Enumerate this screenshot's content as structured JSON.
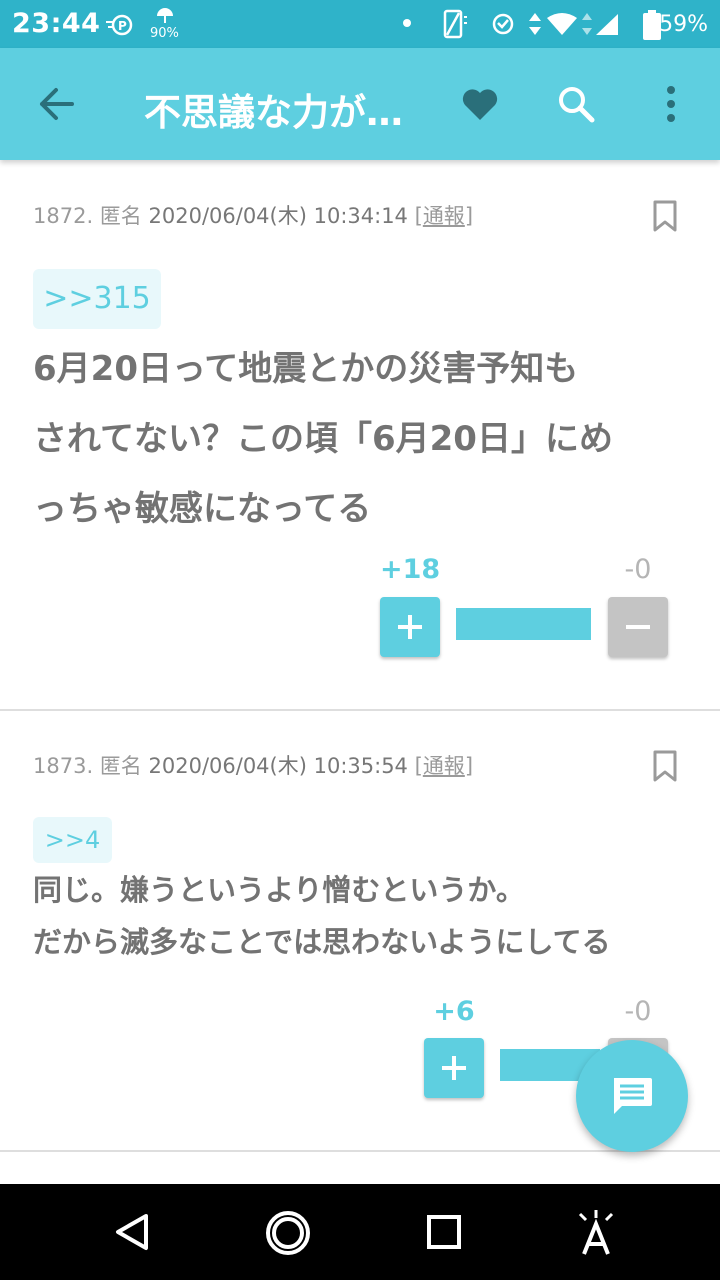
{
  "status_bar": {
    "time": "23:44",
    "small_label": "90%",
    "battery": "59%"
  },
  "app_bar": {
    "title": "不思議な力が…",
    "colors": {
      "bar": "#5ecfe0",
      "status": "#2fb3c9",
      "heart": "#2a6f7a"
    }
  },
  "posts": [
    {
      "number": "1872.",
      "author": "匿名",
      "datetime": "2020/06/04(木) 10:34:14",
      "report_open": "[",
      "report": "通報",
      "report_close": "]",
      "anchor": ">>315",
      "lines": [
        "6月20日って地震とかの災害予知も",
        "されてない？この頃「6月20日」にめ",
        "っちゃ敏感になってる"
      ],
      "plus_count": "+18",
      "minus_count": "-0",
      "plus_fraction": 1.0
    },
    {
      "number": "1873.",
      "author": "匿名",
      "datetime": "2020/06/04(木) 10:35:54",
      "report_open": "[",
      "report": "通報",
      "report_close": "]",
      "anchor": ">>4",
      "lines": [
        "同じ。嫌うというより憎むというか。",
        "だから滅多なことでは思わないようにしてる"
      ],
      "plus_count": "+6",
      "minus_count": "-0",
      "plus_fraction": 1.0
    }
  ],
  "icons": {
    "back": "arrow-left",
    "favorite": "heart",
    "search": "magnifier",
    "menu": "vertical-dots",
    "bookmark": "bookmark-outline",
    "compose": "chat-bubble",
    "nav_back": "triangle-back",
    "nav_home": "circle-home",
    "nav_recents": "square-recents",
    "nav_accessibility": "accessibility-a"
  }
}
